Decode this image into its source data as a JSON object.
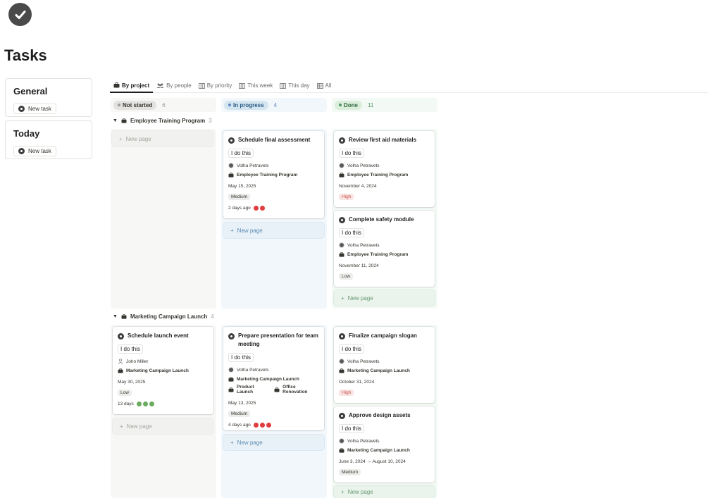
{
  "page": {
    "title": "Tasks",
    "logo_icon": "check-circle-icon"
  },
  "sidebar": {
    "cards": [
      {
        "title": "General",
        "button_label": "New task"
      },
      {
        "title": "Today",
        "button_label": "New task"
      }
    ]
  },
  "tabs": [
    {
      "label": "By project",
      "icon": "briefcase-icon",
      "active": true
    },
    {
      "label": "By people",
      "icon": "people-icon",
      "active": false
    },
    {
      "label": "By priority",
      "icon": "board-icon",
      "active": false
    },
    {
      "label": "This week",
      "icon": "board-icon",
      "active": false
    },
    {
      "label": "This day",
      "icon": "board-icon",
      "active": false
    },
    {
      "label": "All",
      "icon": "table-icon",
      "active": false
    }
  ],
  "columns": [
    {
      "label": "Not started",
      "count": "6",
      "color": "#9b9a97",
      "bg": "#e3e2e0"
    },
    {
      "label": "In progress",
      "count": "4",
      "color": "#5e87c9",
      "bg": "#d3e5ef"
    },
    {
      "label": "Done",
      "count": "11",
      "color": "#4f9768",
      "bg": "#dbeddb"
    }
  ],
  "new_page_label": "New page",
  "groups": [
    {
      "name": "Employee Training Program",
      "count": "3",
      "in_progress": [
        {
          "title": "Schedule final assessment",
          "tag": "I do this",
          "person": "Volha Petravets",
          "projects": [
            "Employee Training Program"
          ],
          "date": "May 15, 2025",
          "priority": "Medium",
          "due": "2 days ago",
          "status_dot_color": "#e03e3e"
        }
      ],
      "done": [
        {
          "title": "Review first aid materials",
          "tag": "I do this",
          "person": "Volha Petravets",
          "projects": [
            "Employee Training Program"
          ],
          "date": "November 4, 2024",
          "priority": "High"
        },
        {
          "title": "Complete safety module",
          "tag": "I do this",
          "person": "Volha Petravets",
          "projects": [
            "Employee Training Program"
          ],
          "date": "November 11, 2024",
          "priority": "Low"
        }
      ]
    },
    {
      "name": "Marketing Campaign Launch",
      "count": "4",
      "not_started": [
        {
          "title": "Schedule launch event",
          "tag": "I do this",
          "person": "John Miller",
          "projects": [
            "Marketing Campaign Launch"
          ],
          "date": "May 30, 2025",
          "priority": "Low",
          "due": "13 days",
          "status_dot_color": "#6aab5e"
        }
      ],
      "in_progress": [
        {
          "title": "Prepare presentation for team meeting",
          "tag": "I do this",
          "person": "Volha Petravets",
          "projects": [
            "Marketing Campaign Launch",
            "Product Launch",
            "Office Renovation"
          ],
          "date": "May 13, 2025",
          "priority": "Medium",
          "due": "4 days ago",
          "status_dot_color": "#e03e3e"
        }
      ],
      "done": [
        {
          "title": "Finalize campaign slogan",
          "tag": "I do this",
          "person": "Volha Petravets",
          "projects": [
            "Marketing Campaign Launch"
          ],
          "date": "October 31, 2024",
          "priority": "High"
        },
        {
          "title": "Approve design assets",
          "tag": "I do this",
          "person": "Volha Petravets",
          "projects": [
            "Marketing Campaign Launch"
          ],
          "date": "June 3, 2024 → August 10, 2024",
          "priority": "Medium"
        }
      ]
    }
  ]
}
